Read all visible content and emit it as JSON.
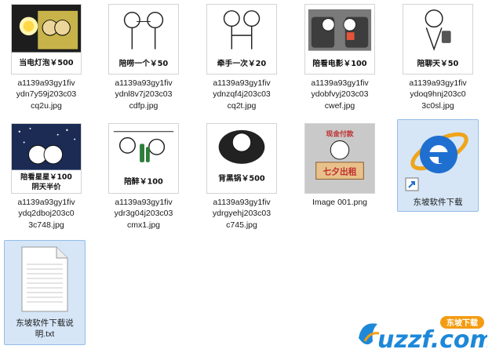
{
  "files": [
    {
      "lines": [
        "a1139a93gy1fiv",
        "ydn7y59j203c03",
        "cq2u.jpg"
      ],
      "overlay": "当电灯泡￥500"
    },
    {
      "lines": [
        "a1139a93gy1fiv",
        "ydnl8v7j203c03",
        "cdfp.jpg"
      ],
      "overlay": "陪唠一个￥50"
    },
    {
      "lines": [
        "a1139a93gy1fiv",
        "ydnzqf4j203c03",
        "cq2t.jpg"
      ],
      "overlay": "牵手一次￥20"
    },
    {
      "lines": [
        "a1139a93gy1fiv",
        "ydobfvyj203c03",
        "cwef.jpg"
      ],
      "overlay": "陪看电影￥100"
    },
    {
      "lines": [
        "a1139a93gy1fiv",
        "ydoq9hnj203c0",
        "3c0sl.jpg"
      ],
      "overlay": "陪聊天￥50"
    },
    {
      "lines": [
        "a1139a93gy1fiv",
        "ydq2dboj203c0",
        "3c748.jpg"
      ],
      "overlay": "陪看星星￥100",
      "overlay2": "阴天半价"
    },
    {
      "lines": [
        "a1139a93gy1fiv",
        "ydr3g04j203c03",
        "cmx1.jpg"
      ],
      "overlay": "陪醉￥100"
    },
    {
      "lines": [
        "a1139a93gy1fiv",
        "ydrgyehj203c03",
        "c745.jpg"
      ],
      "overlay": "背黑锅￥500"
    },
    {
      "lines": [
        "Image 001.png"
      ],
      "overlay": "七夕出租",
      "overlay2": "现金付款"
    },
    {
      "lines": [
        "东坡软件下载"
      ]
    },
    {
      "lines": [
        "东坡软件下载说",
        "明.txt"
      ]
    }
  ],
  "watermark": {
    "site": "uzzf.com",
    "brand": "东坡下载"
  },
  "colors": {
    "selection_bg": "#d6e6f7",
    "selection_border": "#94bde8",
    "ie_blue": "#1f6fd0",
    "ie_orange": "#f0a41a"
  }
}
